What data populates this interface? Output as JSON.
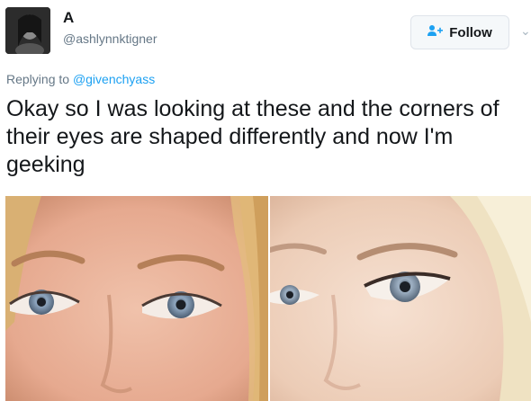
{
  "author": {
    "display_name": "A",
    "handle": "@ashlynnktigner",
    "avatar_icon": "profile-photo"
  },
  "follow_button": {
    "label": "Follow",
    "icon": "add-user-icon",
    "accent": "#1da1f2"
  },
  "menu": {
    "icon": "chevron-down-icon",
    "glyph": "⌄"
  },
  "reply": {
    "prefix": "Replying to",
    "mention": "@givenchyass"
  },
  "tweet": {
    "text": "Okay so I was looking at these and the corners of their eyes are shaped differently and now I'm geeking"
  },
  "media": {
    "left_photo": "face-photo-left",
    "right_photo": "face-photo-right"
  },
  "colors": {
    "text_primary": "#14171a",
    "text_secondary": "#657786",
    "link": "#1da1f2",
    "button_bg": "#f5f8fa",
    "button_border": "#dfe4ea"
  }
}
